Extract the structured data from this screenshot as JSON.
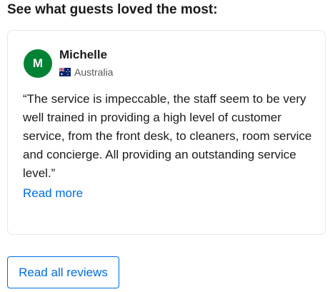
{
  "section": {
    "heading": "See what guests loved the most:"
  },
  "review": {
    "avatar_initial": "M",
    "avatar_color": "#008234",
    "reviewer_name": "Michelle",
    "country": "Australia",
    "country_flag_icon": "australia-flag-icon",
    "text": "“The service is impeccable, the staff seem to be very well trained in providing a high level of customer service, from the front desk, to cleaners, room service and concierge. All providing an outstanding service level.”",
    "read_more_label": "Read more"
  },
  "actions": {
    "read_all_reviews_label": "Read all reviews",
    "accent_color": "#006ce4"
  }
}
